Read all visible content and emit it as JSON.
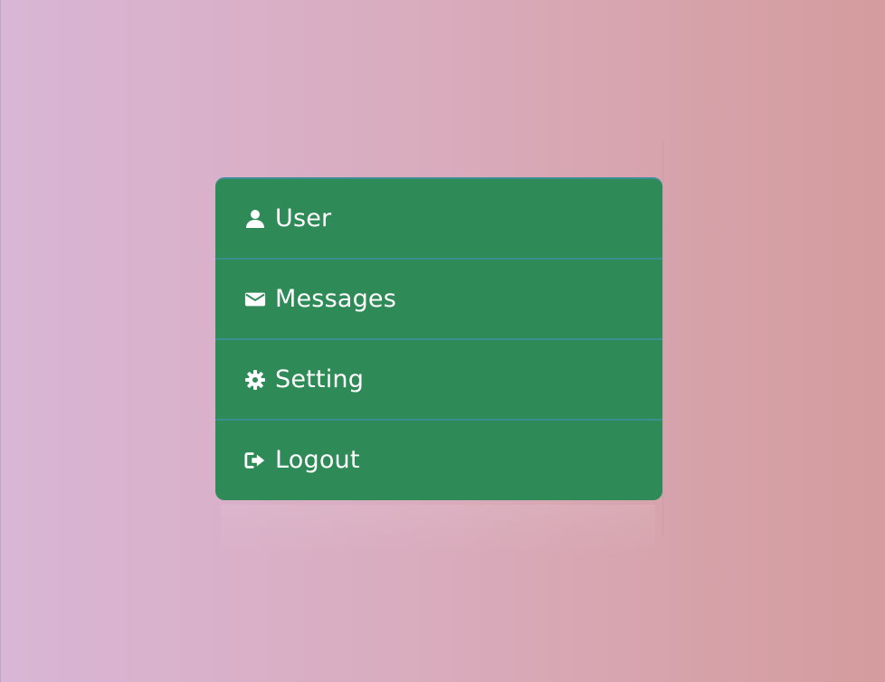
{
  "menu": {
    "items": [
      {
        "label": "User",
        "icon": "user-icon"
      },
      {
        "label": "Messages",
        "icon": "envelope-icon"
      },
      {
        "label": "Setting",
        "icon": "gear-icon"
      },
      {
        "label": "Logout",
        "icon": "logout-icon"
      }
    ]
  },
  "theme": {
    "menu_background": "#2e8b57",
    "divider_color": "#3b8f91",
    "text_color": "#ffffff",
    "page_gradient_start": "#d9b6d6",
    "page_gradient_mid": "#d9abbc",
    "page_gradient_end": "#d49c9d"
  }
}
